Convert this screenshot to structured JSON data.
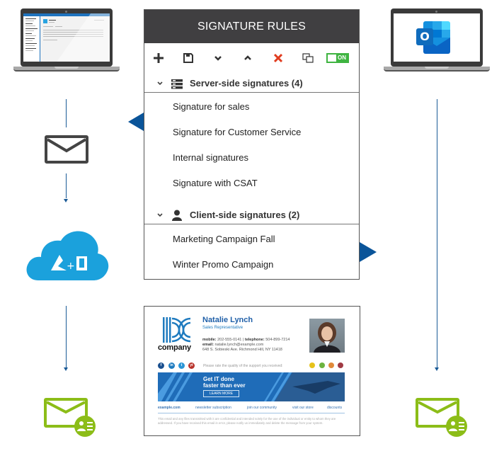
{
  "panel": {
    "title": "SIGNATURE RULES",
    "toolbar": {
      "add": "add-icon",
      "save": "save-icon",
      "move_down": "chevron-down-icon",
      "move_up": "chevron-up-icon",
      "delete": "close-icon",
      "duplicate": "copy-icon",
      "toggle_label": "ON",
      "toggle_state": "on",
      "toggle_color": "#3fb441",
      "delete_color": "#e03c1f"
    },
    "groups": [
      {
        "title": "Server-side signatures (4)",
        "icon": "server-icon",
        "items": [
          "Signature for sales",
          "Signature for Customer Service",
          "Internal signatures",
          "Signature with CSAT"
        ]
      },
      {
        "title": "Client-side signatures (2)",
        "icon": "user-icon",
        "items": [
          "Marketing Campaign Fall",
          "Winter Promo Campaign"
        ]
      }
    ]
  },
  "diagram": {
    "left_laptop": "web-mail-client",
    "right_laptop": "outlook-client",
    "envelope": "envelope-icon",
    "cloud": "azure-office365-cloud-icon",
    "cloud_text": "+",
    "recipient_left": "email-with-signature-icon",
    "recipient_right": "email-with-signature-icon",
    "accent_blue": "#1a5a96",
    "cloud_color": "#1ba1dc",
    "green": "#8cbd18"
  },
  "signature": {
    "company": "company",
    "name": "Natalie Lynch",
    "role": "Sales Representative",
    "mobile_label": "mobile:",
    "mobile": "202-555-0141",
    "separator": "|",
    "telephone_label": "telephone:",
    "telephone": "504-899-7214",
    "email_label": "email:",
    "email": "natalie.lynch@example.com",
    "address": "648 S. Sobieski Ave. Richmond Hill, NY 11418",
    "social": [
      "f",
      "in",
      "t",
      "yt"
    ],
    "rate_prompt": "Please rate the quality of the support you received:",
    "banner_title_1": "Get IT done",
    "banner_title_2": "faster than ever",
    "banner_button": "LEARN MORE",
    "links": [
      "example.com",
      "newsletter subscription",
      "join our community",
      "visit our store",
      "discounts"
    ],
    "disclaimer": "This email and any files transmitted with it are confidential and intended solely for the use of the individual or entity to whom they are addressed. If you have received this email in error, please notify us immediately and delete the message from your system."
  }
}
